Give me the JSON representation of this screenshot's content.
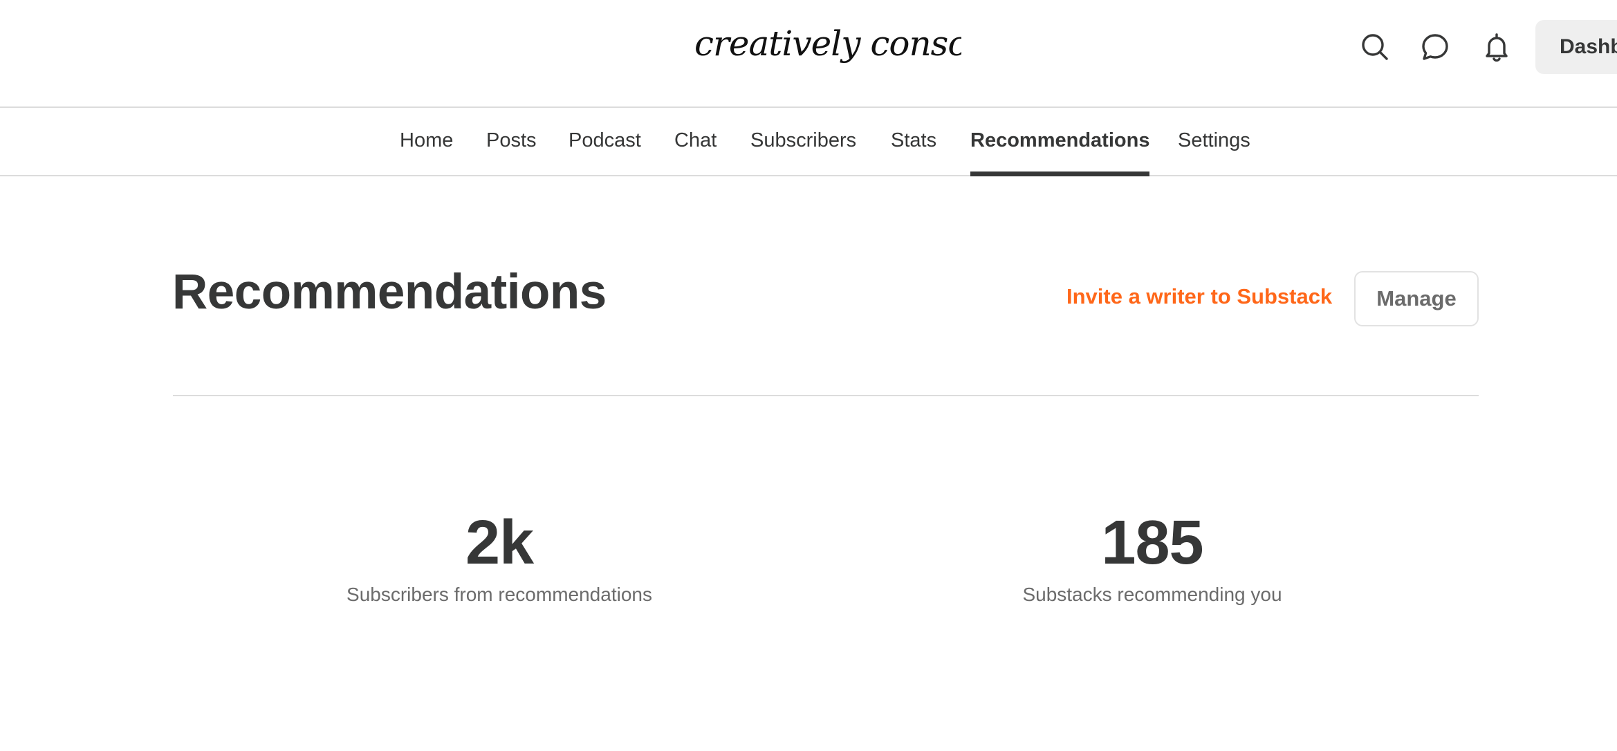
{
  "header": {
    "logo_text": "creatively conscious",
    "dashboard_label": "Dashb"
  },
  "icons": {
    "search": "search-icon",
    "chat": "chat-bubble-icon",
    "notifications": "bell-icon"
  },
  "nav": {
    "tabs": [
      {
        "label": "Home"
      },
      {
        "label": "Posts"
      },
      {
        "label": "Podcast"
      },
      {
        "label": "Chat"
      },
      {
        "label": "Subscribers"
      },
      {
        "label": "Stats"
      },
      {
        "label": "Recommendations",
        "active": true
      },
      {
        "label": "Settings"
      }
    ]
  },
  "page": {
    "title": "Recommendations",
    "invite_label": "Invite a writer to Substack",
    "manage_label": "Manage"
  },
  "stats": [
    {
      "value": "2k",
      "label": "Subscribers from recommendations"
    },
    {
      "value": "185",
      "label": "Substacks recommending you"
    }
  ],
  "colors": {
    "accent": "#ff6719",
    "text": "#363737",
    "muted": "#6b6b6b",
    "border": "#dcdcdc"
  }
}
